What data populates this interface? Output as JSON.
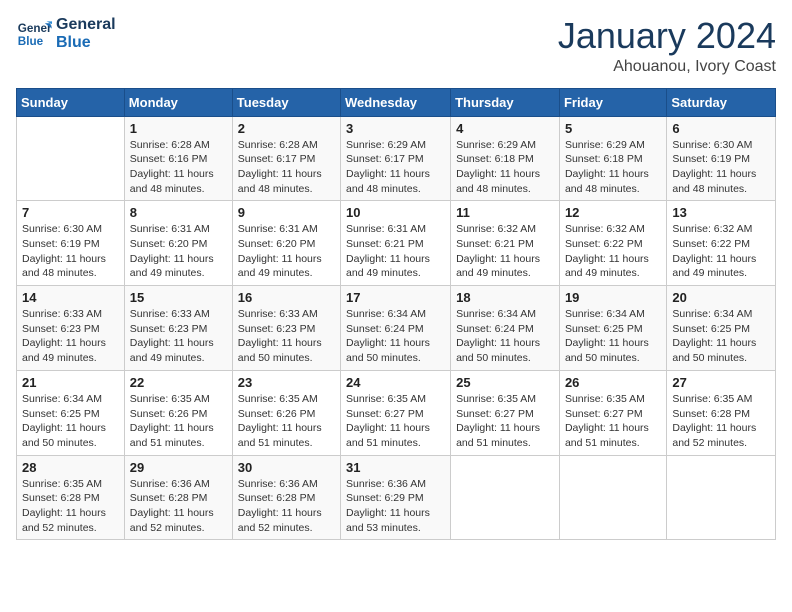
{
  "header": {
    "logo_line1": "General",
    "logo_line2": "Blue",
    "month": "January 2024",
    "location": "Ahouanou, Ivory Coast"
  },
  "days": [
    "Sunday",
    "Monday",
    "Tuesday",
    "Wednesday",
    "Thursday",
    "Friday",
    "Saturday"
  ],
  "weeks": [
    [
      {
        "date": "",
        "info": ""
      },
      {
        "date": "1",
        "info": "Sunrise: 6:28 AM\nSunset: 6:16 PM\nDaylight: 11 hours and 48 minutes."
      },
      {
        "date": "2",
        "info": "Sunrise: 6:28 AM\nSunset: 6:17 PM\nDaylight: 11 hours and 48 minutes."
      },
      {
        "date": "3",
        "info": "Sunrise: 6:29 AM\nSunset: 6:17 PM\nDaylight: 11 hours and 48 minutes."
      },
      {
        "date": "4",
        "info": "Sunrise: 6:29 AM\nSunset: 6:18 PM\nDaylight: 11 hours and 48 minutes."
      },
      {
        "date": "5",
        "info": "Sunrise: 6:29 AM\nSunset: 6:18 PM\nDaylight: 11 hours and 48 minutes."
      },
      {
        "date": "6",
        "info": "Sunrise: 6:30 AM\nSunset: 6:19 PM\nDaylight: 11 hours and 48 minutes."
      }
    ],
    [
      {
        "date": "7",
        "info": "Sunrise: 6:30 AM\nSunset: 6:19 PM\nDaylight: 11 hours and 48 minutes."
      },
      {
        "date": "8",
        "info": "Sunrise: 6:31 AM\nSunset: 6:20 PM\nDaylight: 11 hours and 49 minutes."
      },
      {
        "date": "9",
        "info": "Sunrise: 6:31 AM\nSunset: 6:20 PM\nDaylight: 11 hours and 49 minutes."
      },
      {
        "date": "10",
        "info": "Sunrise: 6:31 AM\nSunset: 6:21 PM\nDaylight: 11 hours and 49 minutes."
      },
      {
        "date": "11",
        "info": "Sunrise: 6:32 AM\nSunset: 6:21 PM\nDaylight: 11 hours and 49 minutes."
      },
      {
        "date": "12",
        "info": "Sunrise: 6:32 AM\nSunset: 6:22 PM\nDaylight: 11 hours and 49 minutes."
      },
      {
        "date": "13",
        "info": "Sunrise: 6:32 AM\nSunset: 6:22 PM\nDaylight: 11 hours and 49 minutes."
      }
    ],
    [
      {
        "date": "14",
        "info": "Sunrise: 6:33 AM\nSunset: 6:23 PM\nDaylight: 11 hours and 49 minutes."
      },
      {
        "date": "15",
        "info": "Sunrise: 6:33 AM\nSunset: 6:23 PM\nDaylight: 11 hours and 49 minutes."
      },
      {
        "date": "16",
        "info": "Sunrise: 6:33 AM\nSunset: 6:23 PM\nDaylight: 11 hours and 50 minutes."
      },
      {
        "date": "17",
        "info": "Sunrise: 6:34 AM\nSunset: 6:24 PM\nDaylight: 11 hours and 50 minutes."
      },
      {
        "date": "18",
        "info": "Sunrise: 6:34 AM\nSunset: 6:24 PM\nDaylight: 11 hours and 50 minutes."
      },
      {
        "date": "19",
        "info": "Sunrise: 6:34 AM\nSunset: 6:25 PM\nDaylight: 11 hours and 50 minutes."
      },
      {
        "date": "20",
        "info": "Sunrise: 6:34 AM\nSunset: 6:25 PM\nDaylight: 11 hours and 50 minutes."
      }
    ],
    [
      {
        "date": "21",
        "info": "Sunrise: 6:34 AM\nSunset: 6:25 PM\nDaylight: 11 hours and 50 minutes."
      },
      {
        "date": "22",
        "info": "Sunrise: 6:35 AM\nSunset: 6:26 PM\nDaylight: 11 hours and 51 minutes."
      },
      {
        "date": "23",
        "info": "Sunrise: 6:35 AM\nSunset: 6:26 PM\nDaylight: 11 hours and 51 minutes."
      },
      {
        "date": "24",
        "info": "Sunrise: 6:35 AM\nSunset: 6:27 PM\nDaylight: 11 hours and 51 minutes."
      },
      {
        "date": "25",
        "info": "Sunrise: 6:35 AM\nSunset: 6:27 PM\nDaylight: 11 hours and 51 minutes."
      },
      {
        "date": "26",
        "info": "Sunrise: 6:35 AM\nSunset: 6:27 PM\nDaylight: 11 hours and 51 minutes."
      },
      {
        "date": "27",
        "info": "Sunrise: 6:35 AM\nSunset: 6:28 PM\nDaylight: 11 hours and 52 minutes."
      }
    ],
    [
      {
        "date": "28",
        "info": "Sunrise: 6:35 AM\nSunset: 6:28 PM\nDaylight: 11 hours and 52 minutes."
      },
      {
        "date": "29",
        "info": "Sunrise: 6:36 AM\nSunset: 6:28 PM\nDaylight: 11 hours and 52 minutes."
      },
      {
        "date": "30",
        "info": "Sunrise: 6:36 AM\nSunset: 6:28 PM\nDaylight: 11 hours and 52 minutes."
      },
      {
        "date": "31",
        "info": "Sunrise: 6:36 AM\nSunset: 6:29 PM\nDaylight: 11 hours and 53 minutes."
      },
      {
        "date": "",
        "info": ""
      },
      {
        "date": "",
        "info": ""
      },
      {
        "date": "",
        "info": ""
      }
    ]
  ]
}
